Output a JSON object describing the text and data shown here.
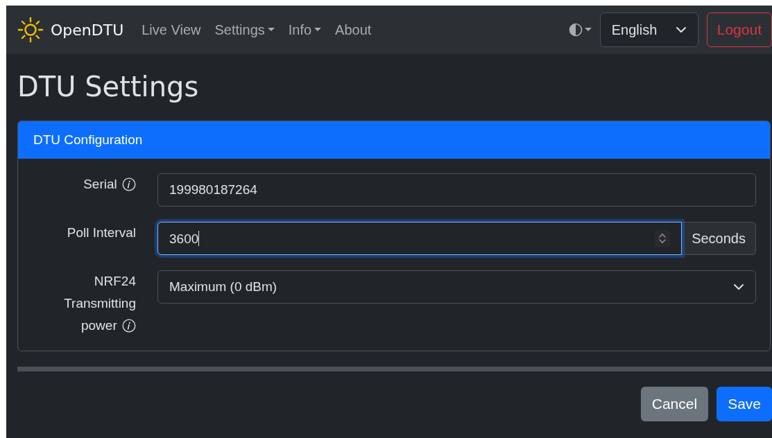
{
  "navbar": {
    "brand": "OpenDTU",
    "items": [
      {
        "label": "Live View",
        "dropdown": false
      },
      {
        "label": "Settings",
        "dropdown": true
      },
      {
        "label": "Info",
        "dropdown": true
      },
      {
        "label": "About",
        "dropdown": false
      }
    ],
    "language": "English",
    "logout": "Logout"
  },
  "page_title": "DTU Settings",
  "card": {
    "header": "DTU Configuration",
    "fields": [
      {
        "kind": "text",
        "label": "Serial",
        "info": true,
        "value": "199980187264",
        "focused": false
      },
      {
        "kind": "number",
        "label": "Poll Interval",
        "info": false,
        "value": "3600",
        "focused": true,
        "unit": "Seconds"
      },
      {
        "kind": "select",
        "label": "NRF24 Transmitting power",
        "info": true,
        "value": "Maximum (0 dBm)",
        "focused": false
      }
    ]
  },
  "buttons": [
    {
      "label": "Cancel",
      "kind": "secondary"
    },
    {
      "label": "Save",
      "kind": "primary"
    }
  ]
}
